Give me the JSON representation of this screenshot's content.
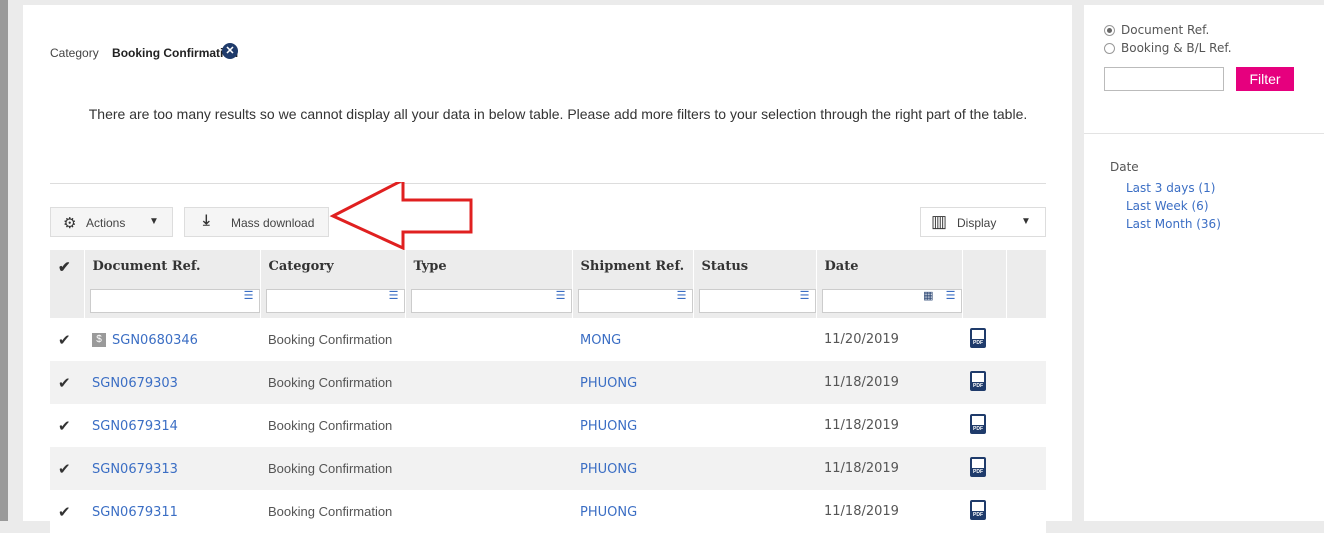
{
  "category_filter": {
    "label": "Category",
    "value": "Booking Confirmation"
  },
  "warning": "There are too many results so we cannot display all your data in below table. Please add more filters to your selection through the right part of the table.",
  "toolbar": {
    "actions_label": "Actions",
    "mass_download_label": "Mass download",
    "display_label": "Display"
  },
  "table": {
    "headers": [
      "Document Ref.",
      "Category",
      "Type",
      "Shipment Ref.",
      "Status",
      "Date"
    ],
    "rows": [
      {
        "doc_ref": "SGN0680346",
        "category": "Booking Confirmation",
        "type": "",
        "shipment_ref": "MONG",
        "status": "",
        "date": "11/20/2019"
      },
      {
        "doc_ref": "SGN0679303",
        "category": "Booking Confirmation",
        "type": "",
        "shipment_ref": "PHUONG",
        "status": "",
        "date": "11/18/2019"
      },
      {
        "doc_ref": "SGN0679314",
        "category": "Booking Confirmation",
        "type": "",
        "shipment_ref": "PHUONG",
        "status": "",
        "date": "11/18/2019"
      },
      {
        "doc_ref": "SGN0679313",
        "category": "Booking Confirmation",
        "type": "",
        "shipment_ref": "PHUONG",
        "status": "",
        "date": "11/18/2019"
      },
      {
        "doc_ref": "SGN0679311",
        "category": "Booking Confirmation",
        "type": "",
        "shipment_ref": "PHUONG",
        "status": "",
        "date": "11/18/2019"
      }
    ]
  },
  "sidebar": {
    "radio_document_ref": "Document Ref.",
    "radio_booking_bl_ref": "Booking & B/L Ref.",
    "filter_button": "Filter",
    "date_heading": "Date",
    "date_links": [
      "Last 3 days (1)",
      "Last Week (6)",
      "Last Month (36)"
    ]
  },
  "colors": {
    "accent": "#e6007e",
    "link": "#3b6ec4",
    "arrow": "#e02020",
    "icon_navy": "#1f3b6b"
  }
}
